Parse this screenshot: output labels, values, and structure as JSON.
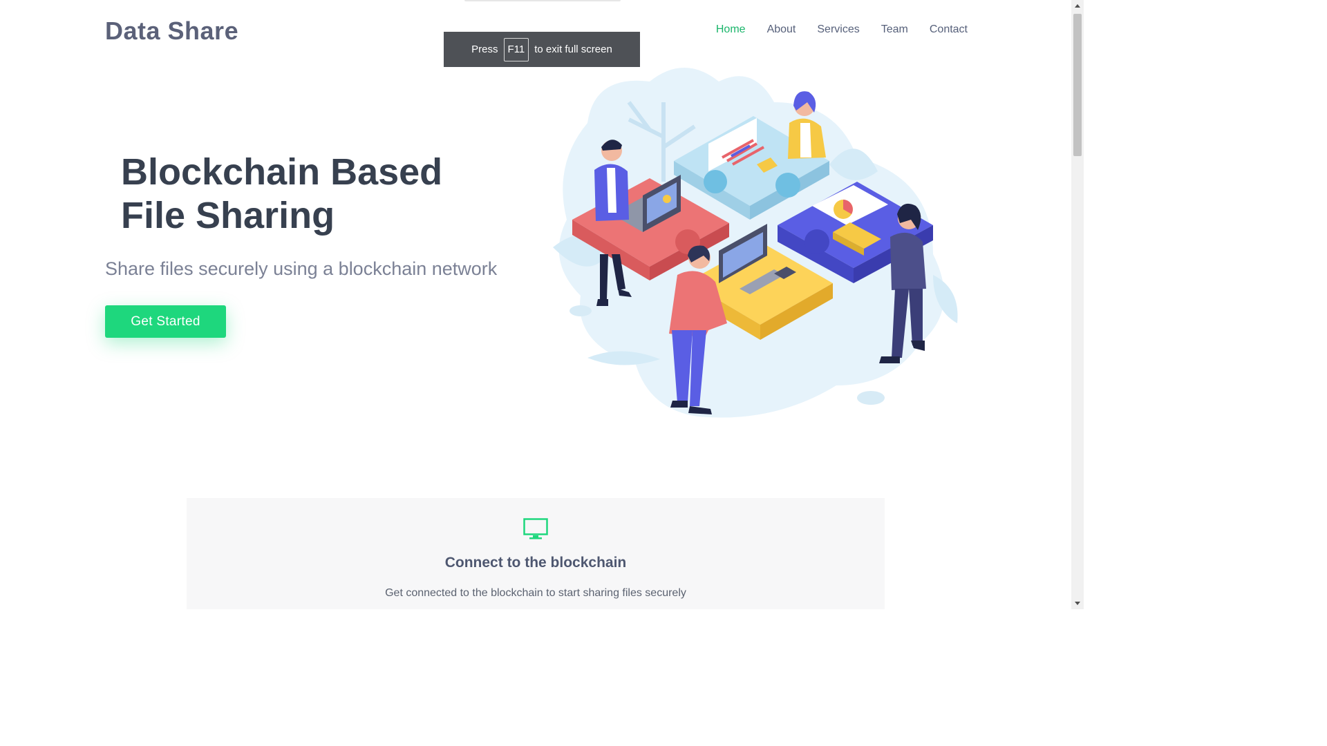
{
  "brand": {
    "name": "Data Share"
  },
  "nav": {
    "items": [
      {
        "label": "Home",
        "active": true
      },
      {
        "label": "About",
        "active": false
      },
      {
        "label": "Services",
        "active": false
      },
      {
        "label": "Team",
        "active": false
      },
      {
        "label": "Contact",
        "active": false
      }
    ]
  },
  "hero": {
    "title_line1": "Blockchain Based",
    "title_line2": "File Sharing",
    "subtitle": "Share files securely using a blockchain network",
    "cta_label": "Get Started",
    "illustration_icon": "puzzle-teamwork-illustration"
  },
  "fullscreen_notice": {
    "prefix": "Press",
    "key": "F11",
    "suffix": "to exit full screen"
  },
  "feature": {
    "icon": "monitor-icon",
    "title": "Connect to the blockchain",
    "description": "Get connected to the blockchain to start sharing files securely"
  },
  "colors": {
    "accent": "#1ed77d",
    "nav_active": "#1bb56b",
    "heading": "#37404f",
    "brand": "#5b6179"
  }
}
